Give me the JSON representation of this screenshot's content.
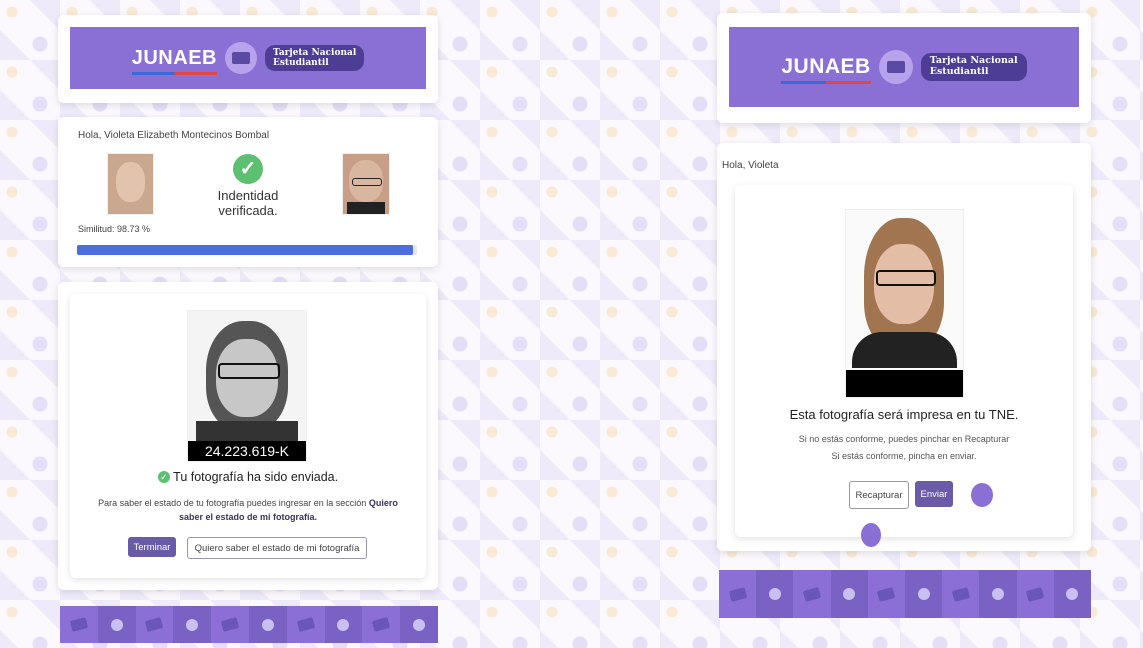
{
  "brand": {
    "logo_text": "JUNAEB",
    "tne_line1": "Tarjeta Nacional",
    "tne_line2": "Estudiantil",
    "badge_small": "TNE"
  },
  "left": {
    "greeting": "Hola, Violeta Elizabeth Montecinos Bombal",
    "verified_line1": "Indentidad",
    "verified_line2": "verificada.",
    "similarity": "Similitud: 98.73 %",
    "similarity_value": 98.73,
    "rut": "24.223.619-K",
    "sent_message": "Tu fotografía ha sido enviada.",
    "info_text": "Para saber el estado de tu fotografía puedes ingresar en la sección ",
    "info_bold": "Quiero saber el estado de mi fotografía.",
    "btn_finish": "Terminar",
    "btn_status": "Quiero saber el estado de mi fotografía"
  },
  "right": {
    "greeting": "Hola, Violeta",
    "headline": "Esta fotografía será impresa en tu TNE.",
    "line1": "Si no estás conforme, puedes pinchar en Recapturar",
    "line2": "Si estás conforme, pincha en enviar.",
    "btn_recapture": "Recapturar",
    "btn_send": "Enviar"
  },
  "colors": {
    "banner": "#8a6fd4",
    "progress": "#4a6ee0",
    "check": "#5cc070",
    "primary_button": "#6a5aa8"
  }
}
